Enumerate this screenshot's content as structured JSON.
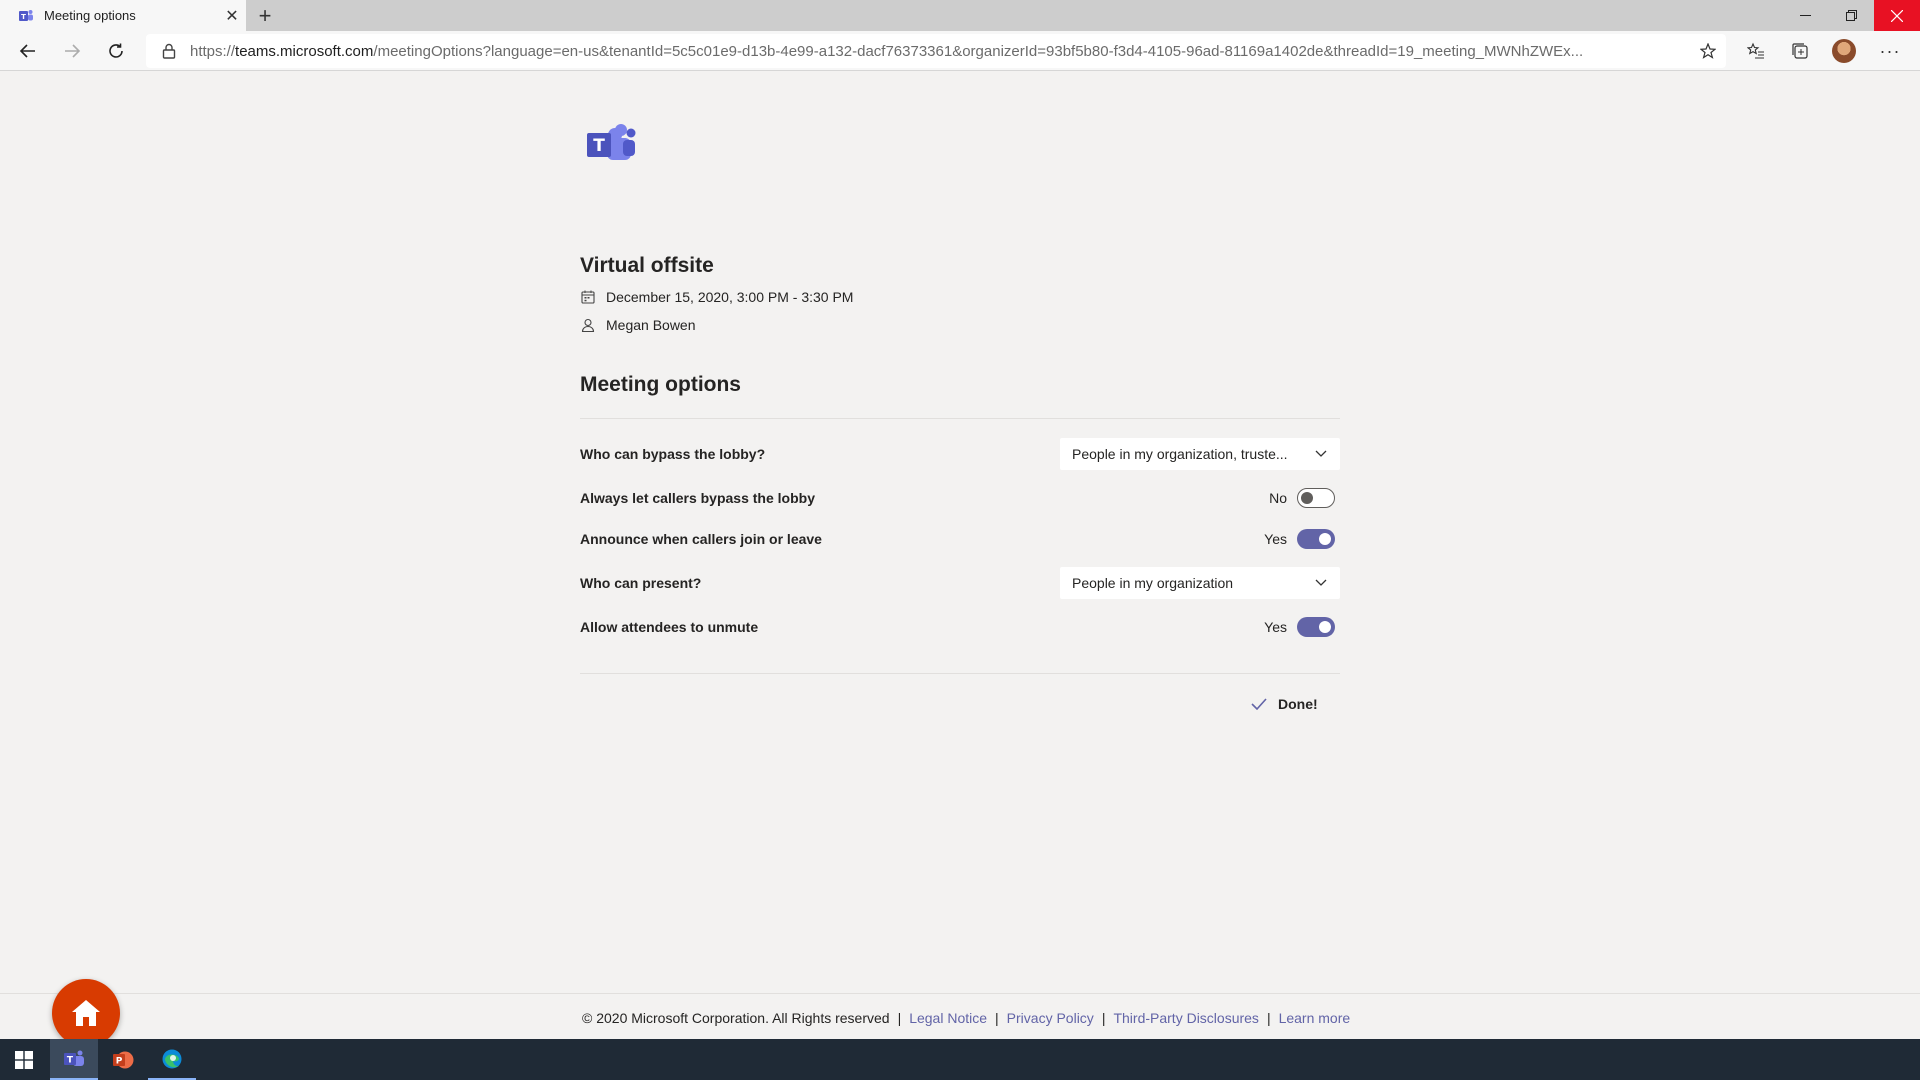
{
  "browser": {
    "tab_title": "Meeting options",
    "url_scheme": "https://",
    "url_host": "teams.microsoft.com",
    "url_rest": "/meetingOptions?language=en-us&tenantId=5c5c01e9-d13b-4e99-a132-dacf76373361&organizerId=93bf5b80-f3d4-4105-96ad-81169a1402de&threadId=19_meeting_MWNhZWEx..."
  },
  "meeting": {
    "title": "Virtual offsite",
    "datetime": "December 15, 2020, 3:00 PM - 3:30 PM",
    "organizer": "Megan Bowen"
  },
  "options": {
    "section_title": "Meeting options",
    "bypass_lobby": {
      "label": "Who can bypass the lobby?",
      "value": "People in my organization, truste..."
    },
    "callers_bypass": {
      "label": "Always let callers bypass the lobby",
      "state_text": "No",
      "on": false
    },
    "announce": {
      "label": "Announce when callers join or leave",
      "state_text": "Yes",
      "on": true
    },
    "present": {
      "label": "Who can present?",
      "value": "People in my organization"
    },
    "unmute": {
      "label": "Allow attendees to unmute",
      "state_text": "Yes",
      "on": true
    },
    "done_label": "Done!"
  },
  "footer": {
    "copyright": "© 2020 Microsoft Corporation. All Rights reserved",
    "sep": "|",
    "links": [
      "Legal Notice",
      "Privacy Policy",
      "Third-Party Disclosures",
      "Learn more"
    ]
  },
  "colors": {
    "accent": "#6264a7",
    "home_fab": "#d83b01",
    "taskbar": "#1f2a36"
  },
  "icons": [
    "teams-logo-icon",
    "calendar-icon",
    "person-icon",
    "chevron-down-icon",
    "checkmark-icon",
    "home-icon"
  ]
}
